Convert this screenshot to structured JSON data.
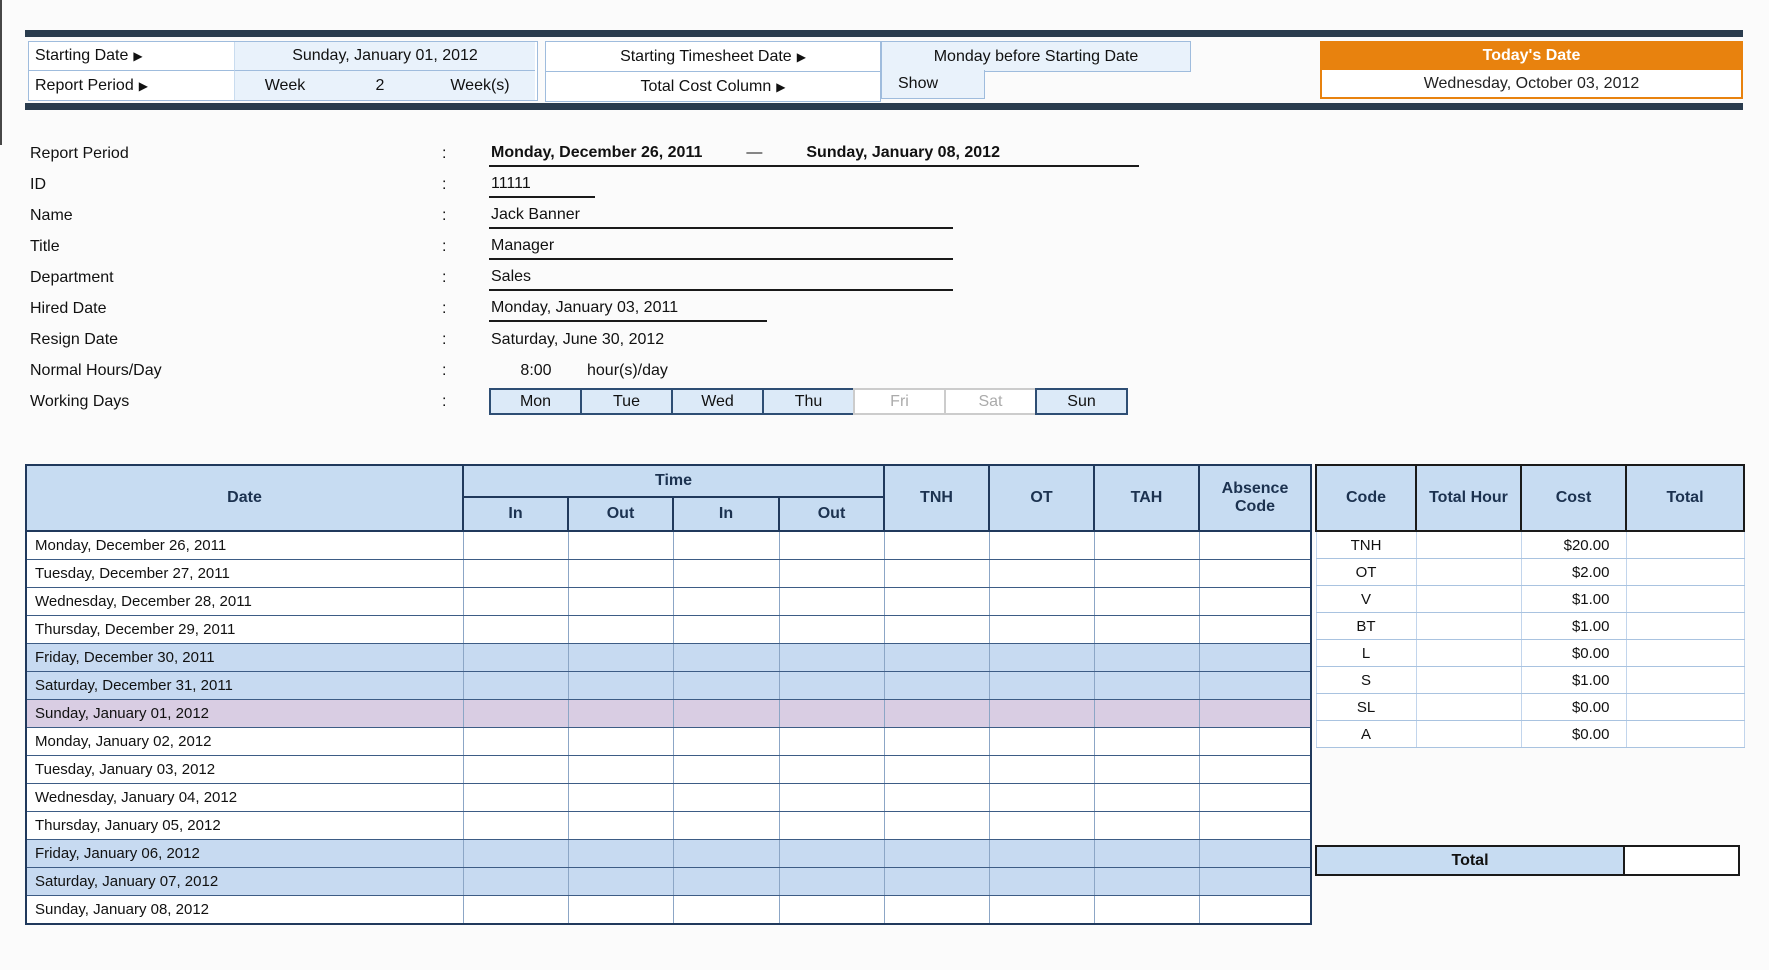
{
  "colors": {
    "accent_orange": "#E8820E",
    "header_blue": "#C7DCF2",
    "weekend_row_blue": "#C7DAF1",
    "holiday_row_purple": "#D9CDE3",
    "settings_value_blue": "#E9F2FB",
    "dark_bar": "#2A3C4E",
    "table_border_dark": "#20395C"
  },
  "settings": {
    "arrow_icon": "▶",
    "starting_date": {
      "label": "Starting Date",
      "value": "Sunday, January 01, 2012"
    },
    "report_period": {
      "label": "Report Period",
      "week_label": "Week",
      "week_value": "2",
      "week_unit": "Week(s)"
    },
    "starting_timesheet_date": {
      "label": "Starting Timesheet Date",
      "value": "Monday before Starting Date"
    },
    "total_cost_column": {
      "label": "Total Cost Column",
      "value": "Show"
    },
    "todays_date": {
      "title": "Today's Date",
      "value": "Wednesday, October 03, 2012"
    }
  },
  "employee": {
    "colon": ":",
    "report_period": {
      "label": "Report Period",
      "start": "Monday, December 26, 2011",
      "dash": "—",
      "end": "Sunday, January 08, 2012"
    },
    "id": {
      "label": "ID",
      "value": "11111"
    },
    "name": {
      "label": "Name",
      "value": "Jack Banner"
    },
    "title": {
      "label": "Title",
      "value": "Manager"
    },
    "department": {
      "label": "Department",
      "value": "Sales"
    },
    "hired_date": {
      "label": "Hired Date",
      "value": "Monday, January 03, 2011"
    },
    "resign_date": {
      "label": "Resign Date",
      "value": "Saturday, June 30, 2012"
    },
    "normal_hours": {
      "label": "Normal Hours/Day",
      "value": "8:00",
      "unit": "hour(s)/day"
    },
    "working_days": {
      "label": "Working Days",
      "days": [
        {
          "name": "Mon",
          "active": true
        },
        {
          "name": "Tue",
          "active": true
        },
        {
          "name": "Wed",
          "active": true
        },
        {
          "name": "Thu",
          "active": true
        },
        {
          "name": "Fri",
          "active": false
        },
        {
          "name": "Sat",
          "active": false
        },
        {
          "name": "Sun",
          "active": true
        }
      ]
    }
  },
  "timesheet": {
    "headers": {
      "date": "Date",
      "time": "Time",
      "in1": "In",
      "out1": "Out",
      "in2": "In",
      "out2": "Out",
      "tnh": "TNH",
      "ot": "OT",
      "tah": "TAH",
      "absence_line1": "Absence",
      "absence_line2": "Code"
    },
    "rows": [
      {
        "date": "Monday, December 26, 2011",
        "highlight": "none"
      },
      {
        "date": "Tuesday, December 27, 2011",
        "highlight": "none"
      },
      {
        "date": "Wednesday, December 28, 2011",
        "highlight": "none"
      },
      {
        "date": "Thursday, December 29, 2011",
        "highlight": "none"
      },
      {
        "date": "Friday, December 30, 2011",
        "highlight": "weekend"
      },
      {
        "date": "Saturday, December 31, 2011",
        "highlight": "weekend"
      },
      {
        "date": "Sunday, January 01, 2012",
        "highlight": "holiday"
      },
      {
        "date": "Monday, January 02, 2012",
        "highlight": "none"
      },
      {
        "date": "Tuesday, January 03, 2012",
        "highlight": "none"
      },
      {
        "date": "Wednesday, January 04, 2012",
        "highlight": "none"
      },
      {
        "date": "Thursday, January 05, 2012",
        "highlight": "none"
      },
      {
        "date": "Friday, January 06, 2012",
        "highlight": "weekend"
      },
      {
        "date": "Saturday, January 07, 2012",
        "highlight": "weekend"
      },
      {
        "date": "Sunday, January 08, 2012",
        "highlight": "none"
      }
    ]
  },
  "rates": {
    "headers": [
      "Code",
      "Total Hour",
      "Cost",
      "Total"
    ],
    "rows": [
      {
        "code": "TNH",
        "total_hour": "",
        "cost": "$20.00",
        "total": ""
      },
      {
        "code": "OT",
        "total_hour": "",
        "cost": "$2.00",
        "total": ""
      },
      {
        "code": "V",
        "total_hour": "",
        "cost": "$1.00",
        "total": ""
      },
      {
        "code": "BT",
        "total_hour": "",
        "cost": "$1.00",
        "total": ""
      },
      {
        "code": "L",
        "total_hour": "",
        "cost": "$0.00",
        "total": ""
      },
      {
        "code": "S",
        "total_hour": "",
        "cost": "$1.00",
        "total": ""
      },
      {
        "code": "SL",
        "total_hour": "",
        "cost": "$0.00",
        "total": ""
      },
      {
        "code": "A",
        "total_hour": "",
        "cost": "$0.00",
        "total": ""
      }
    ],
    "total_label": "Total",
    "total_value": ""
  }
}
